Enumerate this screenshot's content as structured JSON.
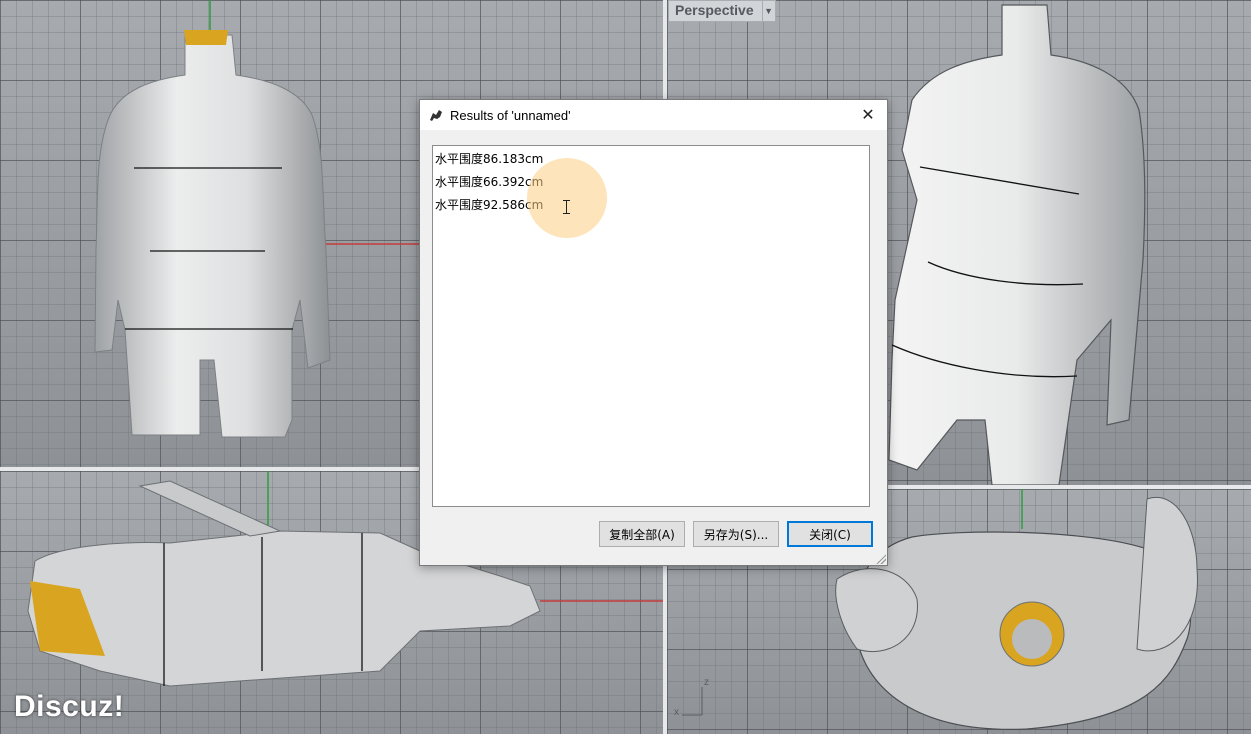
{
  "viewport": {
    "perspective_label": "Perspective",
    "axis_label_x": "x",
    "axis_label_z": "z"
  },
  "watermark": "Discuz!",
  "dialog": {
    "title": "Results of 'unnamed'",
    "lines": [
      "水平围度86.183cm",
      "水平围度66.392cm",
      "水平围度92.586cm"
    ],
    "buttons": {
      "copy_all": "复制全部(A)",
      "save_as": "另存为(S)...",
      "close": "关闭(C)"
    }
  },
  "colors": {
    "body": "#d8d9da",
    "accent": "#d9a520",
    "axis_red": "#c43a3a",
    "axis_green": "#2e9d3c",
    "focus": "#0078d7"
  }
}
